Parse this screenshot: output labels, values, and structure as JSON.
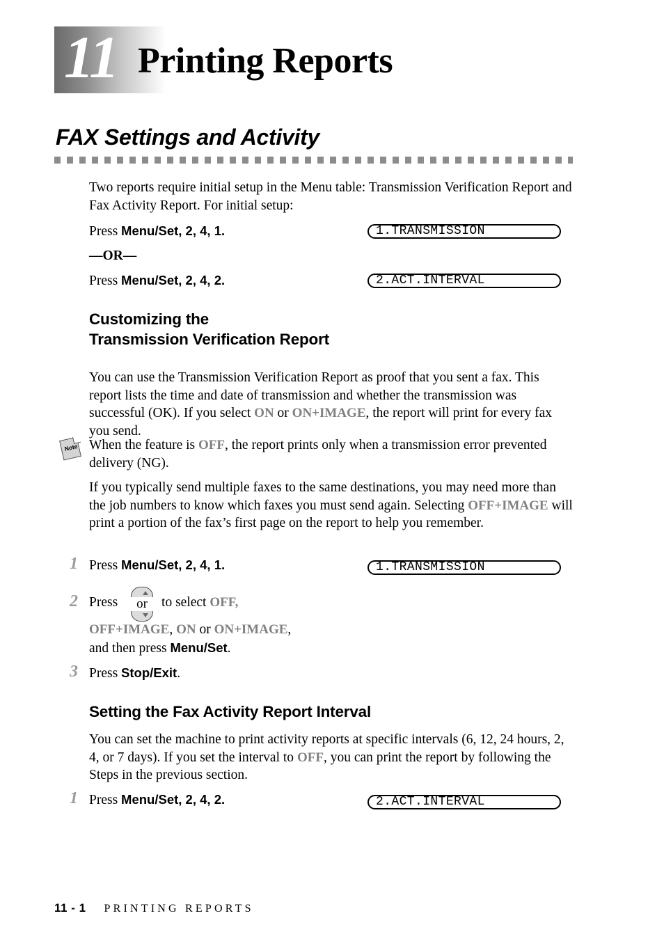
{
  "chapter": {
    "number": "11",
    "title": "Printing Reports"
  },
  "section": {
    "heading": "FAX Settings and Activity"
  },
  "intro": {
    "paragraph": "Two reports require initial setup in the Menu table: Transmission Verification Report and Fax Activity Report. For initial setup:",
    "press_label": "Press",
    "menu_set": "Menu/Set",
    "keys_1": ", 2, 4, 1.",
    "or_divider": "—OR—",
    "keys_2": ", 2, 4, 2."
  },
  "lcd": {
    "transmission": "1.TRANSMISSION",
    "act_interval": "2.ACT.INTERVAL"
  },
  "subsection_1": {
    "heading_line_1": "Customizing the",
    "heading_line_2": "Transmission Verification Report",
    "body_part_1": "You can use the Transmission Verification Report as proof that you sent a fax. This report lists the time and date of transmission and whether the transmission was successful (OK). If you select ",
    "option_on": "ON",
    "body_part_2": " or ",
    "option_on_image": "ON+IMAGE",
    "body_part_3": ", the report will print for every fax you send."
  },
  "note": {
    "icon_label": "Note",
    "text_part_1": "When the feature is ",
    "option_off": "OFF",
    "text_part_2": ", the report prints only when a transmission error prevented delivery (NG)."
  },
  "paragraph_multi": {
    "part_1": "If you typically send multiple faxes to the same destinations, you may need more than the job numbers to know which faxes you must send again. Selecting ",
    "option_off_image": "OFF+IMAGE",
    "part_2": " will print a portion of the fax’s first page on the report to help you remember."
  },
  "steps_1": [
    {
      "number": "1",
      "press_label": "Press",
      "key": "Menu/Set",
      "suffix": ", 2, 4, 1."
    },
    {
      "number": "2",
      "press_label": "Press",
      "mid_label": "to select ",
      "option_off": "OFF,",
      "option_off_image": "OFF+IMAGE",
      "comma_1": ", ",
      "option_on": "ON",
      "or_label": " or ",
      "option_on_image": "ON+IMAGE",
      "comma_2": ",",
      "then_label": "and then press ",
      "key": "Menu/Set",
      "period": "."
    },
    {
      "number": "3",
      "press_label": "Press",
      "key": "Stop/Exit",
      "period": "."
    }
  ],
  "arrow_key": {
    "or_text": "or",
    "up_icon": "arrow-up-icon",
    "down_icon": "arrow-down-icon"
  },
  "subsection_2": {
    "heading": "Setting the Fax Activity Report Interval",
    "body_part_1": "You can set the machine to print activity reports at specific intervals (6, 12, 24 hours, 2, 4, or 7 days). If you set the interval to ",
    "option_off": "OFF",
    "body_part_2": ", you can print the report by following the Steps in the previous section.",
    "step": {
      "number": "1",
      "press_label": "Press",
      "key": "Menu/Set",
      "suffix": ", 2, 4, 2."
    }
  },
  "footer": {
    "page_number": "11 - 1",
    "running_title": "PRINTING REPORTS"
  },
  "colors": {
    "option_gray": "#808080",
    "rule_gray": "#8c8c8c",
    "step_number_gray": "#9a9a9a"
  }
}
